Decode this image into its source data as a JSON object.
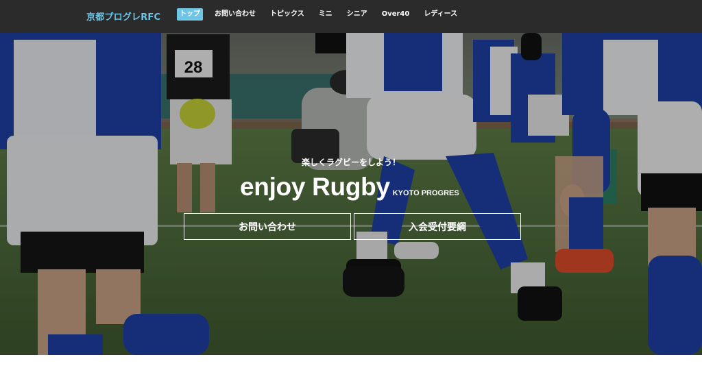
{
  "brand": {
    "name": "京都プログレRFC"
  },
  "nav": {
    "items": [
      {
        "label": "トップ",
        "active": true
      },
      {
        "label": "お問い合わせ",
        "active": false
      },
      {
        "label": "トピックス",
        "active": false
      },
      {
        "label": "ミニ",
        "active": false
      },
      {
        "label": "シニア",
        "active": false
      },
      {
        "label": "Over40",
        "active": false
      },
      {
        "label": "レディース",
        "active": false
      }
    ]
  },
  "hero": {
    "tagline": "楽しくラグビーをしよう！",
    "headline": "enjoy Rugby",
    "headline_sub": "KYOTO PROGRES",
    "buttons": {
      "contact": "お問い合わせ",
      "join": "入会受付要綱"
    },
    "photo": {
      "jersey_number": "28"
    }
  },
  "colors": {
    "accent": "#6ec5e6",
    "navbar_bg": "#2b2b2b",
    "jersey_blue": "#1f3fa6",
    "grass": "#4f6e3e"
  }
}
